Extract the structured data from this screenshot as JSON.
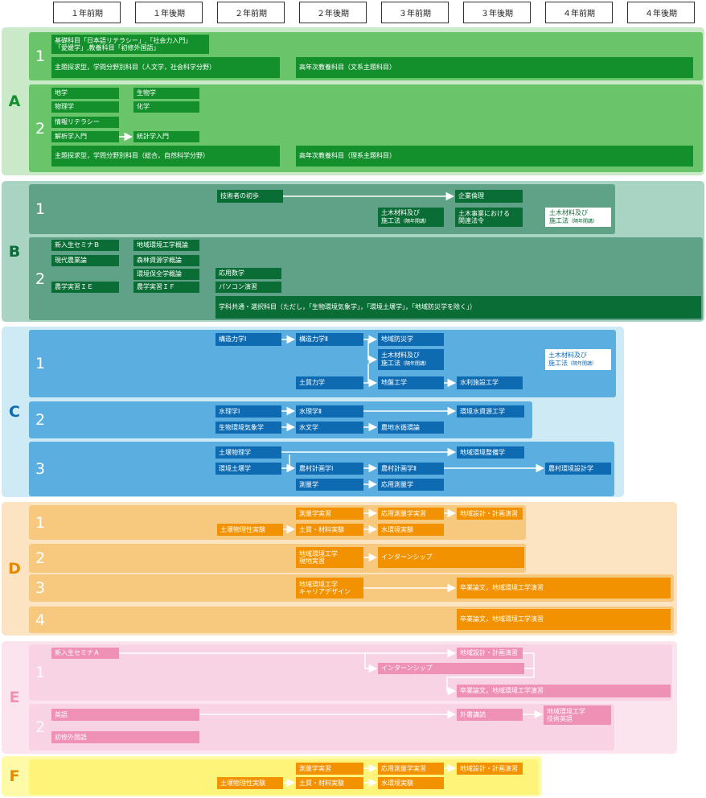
{
  "columns": [
    "１年前期",
    "１年後期",
    "２年前期",
    "２年後期",
    "３年前期",
    "３年後期",
    "４年前期",
    "４年後期"
  ],
  "colors": {
    "A_region": "#c9e9c9",
    "A_lane": "#6ac56a",
    "A_box": "#13902c",
    "B_region": "#a9d4c4",
    "B_lane": "#5fa287",
    "B_box": "#0b6d36",
    "C_region": "#cdeaf5",
    "C_lane": "#5aaee0",
    "C_box": "#0f6bb1",
    "D_region": "#fce4c2",
    "D_lane": "#f7c97e",
    "D_box": "#f39200",
    "E_region": "#fbe4ee",
    "E_lane": "#f8d3e3",
    "E_box": "#ef91b5",
    "F_region": "#fffaa8",
    "F_lane": "#fff47a",
    "F_box": "#f39200"
  },
  "sections": [
    {
      "id": "A",
      "label": "A",
      "lanes": [
        {
          "label": "1",
          "boxes": [
            {
              "lines": [
                "基礎科目「日本語リテラシー」,「社会力入門」",
                "「愛媛学」,教養科目「初修外国語」"
              ]
            },
            {
              "lines": [
                "主題探求型，学問分野別科目（人文学，社会科学分野）"
              ]
            },
            {
              "lines": [
                "高年次教養科目（文系主題科目）"
              ]
            }
          ]
        },
        {
          "label": "2",
          "boxes": [
            {
              "lines": [
                "地学"
              ]
            },
            {
              "lines": [
                "物理学"
              ]
            },
            {
              "lines": [
                "情報リテラシー"
              ]
            },
            {
              "lines": [
                "解析学入門"
              ]
            },
            {
              "lines": [
                "生物学"
              ]
            },
            {
              "lines": [
                "化学"
              ]
            },
            {
              "lines": [
                "統計学入門"
              ]
            },
            {
              "lines": [
                "主題探求型，学問分野別科目（総合，自然科学分野）"
              ]
            },
            {
              "lines": [
                "高年次教養科目（理系主題科目）"
              ]
            }
          ]
        }
      ]
    },
    {
      "id": "B",
      "label": "B",
      "lanes": [
        {
          "label": "1",
          "boxes": [
            {
              "lines": [
                "技術者の初歩"
              ]
            },
            {
              "lines": [
                "企業倫理"
              ]
            },
            {
              "lines": [
                "土木材料及び",
                "施工法"
              ],
              "note": "（隔年開講）"
            },
            {
              "lines": [
                "土木事業における",
                "関連法令"
              ]
            },
            {
              "lines": [
                "土木材料及び",
                "施工法"
              ],
              "note": "（隔年開講）"
            }
          ]
        },
        {
          "label": "2",
          "boxes": [
            {
              "lines": [
                "新入生セミナＢ"
              ]
            },
            {
              "lines": [
                "現代農業論"
              ]
            },
            {
              "lines": [
                "農学実習ＩＥ"
              ]
            },
            {
              "lines": [
                "地域環境工学概論"
              ]
            },
            {
              "lines": [
                "森林資源学概論"
              ]
            },
            {
              "lines": [
                "環境保全学概論"
              ]
            },
            {
              "lines": [
                "農学実習ＩＦ"
              ]
            },
            {
              "lines": [
                "応用数学"
              ]
            },
            {
              "lines": [
                "パソコン演習"
              ]
            },
            {
              "lines": [
                "学科共通・選択科目（ただし，「生物環境気象学」，「環境土壌学」，「地域防災学を除く」）"
              ]
            }
          ]
        }
      ]
    },
    {
      "id": "C",
      "label": "C",
      "lanes": [
        {
          "label": "1",
          "boxes": [
            {
              "lines": [
                "構造力学Ⅰ"
              ]
            },
            {
              "lines": [
                "構造力学Ⅱ"
              ]
            },
            {
              "lines": [
                "地域防災学"
              ]
            },
            {
              "lines": [
                "土木材料及び",
                "施工法"
              ],
              "note": "（隔年開講）"
            },
            {
              "lines": [
                "土質力学"
              ]
            },
            {
              "lines": [
                "地盤工学"
              ]
            },
            {
              "lines": [
                "水利施設工学"
              ]
            },
            {
              "lines": [
                "土木材料及び",
                "施工法"
              ],
              "note": "（隔年開講）"
            }
          ]
        },
        {
          "label": "2",
          "boxes": [
            {
              "lines": [
                "水理学Ⅰ"
              ]
            },
            {
              "lines": [
                "水理学Ⅱ"
              ]
            },
            {
              "lines": [
                "環境水資源工学"
              ]
            },
            {
              "lines": [
                "生物環境気象学"
              ]
            },
            {
              "lines": [
                "水文学"
              ]
            },
            {
              "lines": [
                "農地水循環論"
              ]
            }
          ]
        },
        {
          "label": "3",
          "boxes": [
            {
              "lines": [
                "土壌物理学"
              ]
            },
            {
              "lines": [
                "地域環境整備学"
              ]
            },
            {
              "lines": [
                "環境土壌学"
              ]
            },
            {
              "lines": [
                "農村計画学Ⅰ"
              ]
            },
            {
              "lines": [
                "農村計画学Ⅱ"
              ]
            },
            {
              "lines": [
                "農村環境設計学"
              ]
            },
            {
              "lines": [
                "測量学"
              ]
            },
            {
              "lines": [
                "応用測量学"
              ]
            }
          ]
        }
      ]
    },
    {
      "id": "D",
      "label": "D",
      "lanes": [
        {
          "label": "1",
          "boxes": [
            {
              "lines": [
                "測量学実習"
              ]
            },
            {
              "lines": [
                "応用測量学実習"
              ]
            },
            {
              "lines": [
                "地域設計・計画演習"
              ]
            },
            {
              "lines": [
                "土壌物理性実験"
              ]
            },
            {
              "lines": [
                "土質・材料実験"
              ]
            },
            {
              "lines": [
                "水環境実験"
              ]
            }
          ]
        },
        {
          "label": "2",
          "boxes": [
            {
              "lines": [
                "地域環境工学",
                "現地実習"
              ]
            },
            {
              "lines": [
                "インターンシップ"
              ]
            }
          ]
        },
        {
          "label": "3",
          "boxes": [
            {
              "lines": [
                "地域環境工学",
                "キャリアデザイン"
              ]
            },
            {
              "lines": [
                "卒業論文，地域環境工学演習"
              ]
            }
          ]
        },
        {
          "label": "4",
          "boxes": [
            {
              "lines": [
                "卒業論文，地域環境工学演習"
              ]
            }
          ]
        }
      ]
    },
    {
      "id": "E",
      "label": "E",
      "lanes": [
        {
          "label": "1",
          "boxes": [
            {
              "lines": [
                "新入生セミナＡ"
              ]
            },
            {
              "lines": [
                "地域設計・計画演習"
              ]
            },
            {
              "lines": [
                "インターンシップ"
              ]
            },
            {
              "lines": [
                "卒業論文，地域環境工学演習"
              ]
            }
          ]
        },
        {
          "label": "2",
          "boxes": [
            {
              "lines": [
                "英語"
              ]
            },
            {
              "lines": [
                "外書講読"
              ]
            },
            {
              "lines": [
                "地域環境工学",
                "技術英語"
              ]
            },
            {
              "lines": [
                "初修外国語"
              ]
            }
          ]
        }
      ]
    },
    {
      "id": "F",
      "label": "F",
      "lanes": [
        {
          "label": "",
          "boxes": [
            {
              "lines": [
                "測量学実習"
              ]
            },
            {
              "lines": [
                "応用測量学実習"
              ]
            },
            {
              "lines": [
                "地域設計・計画演習"
              ]
            },
            {
              "lines": [
                "土壌物理性実験"
              ]
            },
            {
              "lines": [
                "土質・材料実験"
              ]
            },
            {
              "lines": [
                "水環境実験"
              ]
            }
          ]
        }
      ]
    }
  ]
}
